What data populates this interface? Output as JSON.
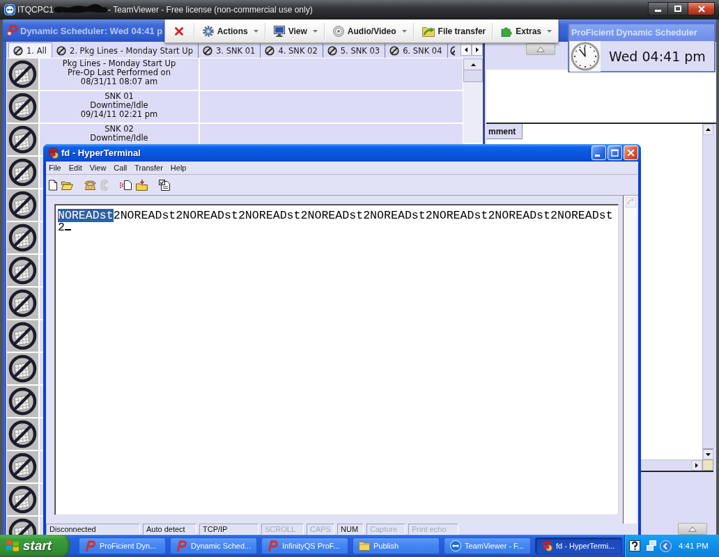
{
  "teamviewer": {
    "title_start": "ITQCPC1",
    "title_end": "- TeamViewer - Free license (non-commercial use only)",
    "toolbar": [
      {
        "kind": "close"
      },
      {
        "kind": "menu",
        "label": "Actions",
        "dropdown": true
      },
      {
        "kind": "menu",
        "label": "View",
        "dropdown": true
      },
      {
        "kind": "menu",
        "label": "Audio/Video",
        "dropdown": true
      },
      {
        "kind": "menu",
        "label": "File transfer",
        "dropdown": false
      },
      {
        "kind": "menu",
        "label": "Extras",
        "dropdown": true
      }
    ]
  },
  "scheduler": {
    "title": "Dynamic Scheduler: Wed 04:41 p",
    "tabs": [
      {
        "label": "1. All",
        "selected": true
      },
      {
        "label": "2. Pkg Lines - Monday Start Up",
        "selected": false
      },
      {
        "label": "3. SNK 01",
        "selected": false
      },
      {
        "label": "4. SNK 02",
        "selected": false
      },
      {
        "label": "5. SNK 03",
        "selected": false
      },
      {
        "label": "6. SNK 04",
        "selected": false
      },
      {
        "selected": false
      }
    ],
    "rows": [
      {
        "kind": "text",
        "title": "Pkg Lines - Monday Start Up",
        "status": "Pre-Op Last Performed on",
        "time": "08/31/11 08:07 am"
      },
      {
        "kind": "text",
        "title": "SNK 01",
        "status": "Downtime/Idle",
        "time": "09/14/11 02:21 pm"
      },
      {
        "kind": "text",
        "title": "SNK 02",
        "status": "Downtime/Idle"
      },
      {
        "kind": "covered"
      },
      {
        "kind": "covered"
      },
      {
        "kind": "covered"
      },
      {
        "kind": "covered"
      },
      {
        "kind": "covered"
      },
      {
        "kind": "covered"
      },
      {
        "kind": "covered"
      },
      {
        "kind": "covered"
      },
      {
        "kind": "covered"
      },
      {
        "kind": "covered"
      },
      {
        "kind": "covered"
      },
      {
        "kind": "covered"
      }
    ],
    "column_header": "mment"
  },
  "clock": {
    "title": "ProFicient Dynamic Scheduler",
    "time": "Wed 04:41 pm"
  },
  "hyperterminal": {
    "title": "fd - HyperTerminal",
    "menu": [
      "File",
      "Edit",
      "View",
      "Call",
      "Transfer",
      "Help"
    ],
    "lines": [
      {
        "segments": [
          {
            "text": "NOREADst",
            "selected": true
          },
          {
            "text": "2NOREADst2NOREADst2NOREADst2NOREADst2NOREADst2NOREADst2NOREADst2NOREADst",
            "selected": false
          }
        ]
      },
      {
        "segments": [
          {
            "text": "2",
            "selected": false
          }
        ]
      }
    ],
    "cursor": true,
    "status_bar": [
      {
        "text": "Disconnected",
        "disabled": false
      },
      {
        "text": "Auto detect",
        "disabled": false
      },
      {
        "text": "TCP/IP",
        "disabled": false
      },
      {
        "text": "SCROLL",
        "disabled": true
      },
      {
        "text": "CAPS",
        "disabled": true
      },
      {
        "text": "NUM",
        "disabled": false
      },
      {
        "text": "Capture",
        "disabled": true
      },
      {
        "text": "Print echo",
        "disabled": true
      }
    ]
  },
  "taskbar": {
    "start": "start",
    "buttons": [
      {
        "label": "ProFicient Dyn...",
        "selected": false
      },
      {
        "label": "Dynamic Sched...",
        "selected": false
      },
      {
        "label": "InfinityQS ProF...",
        "selected": false
      },
      {
        "label": "Publish",
        "selected": false
      },
      {
        "label": "TeamViewer - F...",
        "selected": false
      },
      {
        "label": "fd - HyperTermi...",
        "selected": true
      }
    ],
    "clock": "4:41 PM"
  }
}
